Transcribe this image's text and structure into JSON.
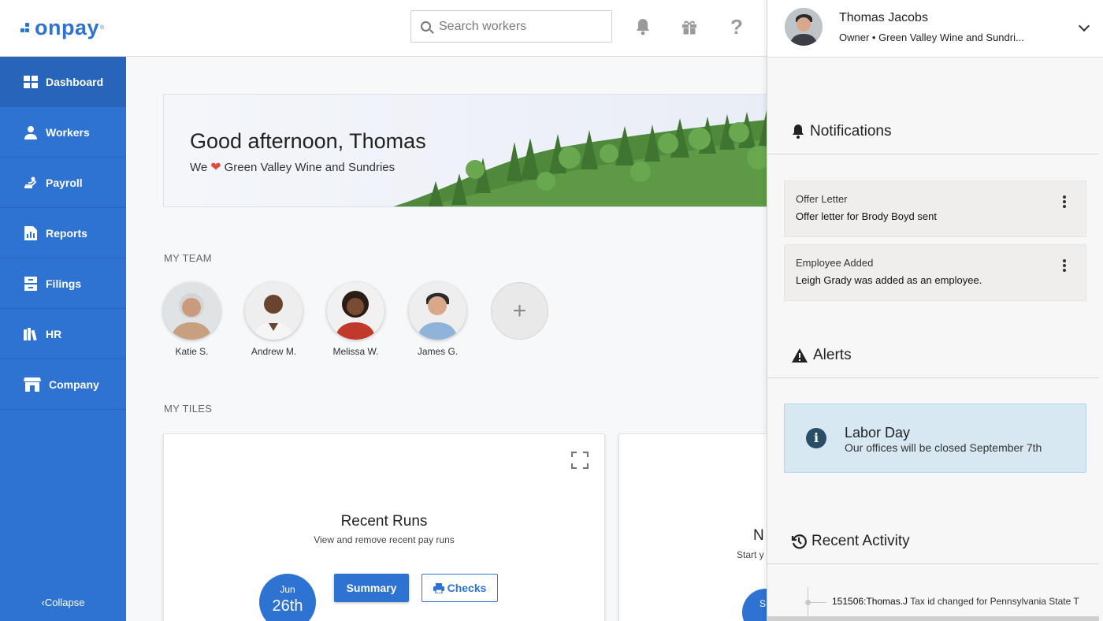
{
  "brand": {
    "name": "onpay",
    "color": "#2e72d2"
  },
  "search": {
    "placeholder": "Search workers"
  },
  "topbar_icons": [
    "bell-icon",
    "gift-icon",
    "help-icon"
  ],
  "user": {
    "name": "Thomas Jacobs",
    "role": "Owner • Green Valley Wine and Sundri..."
  },
  "sidebar": {
    "items": [
      {
        "label": "Dashboard",
        "icon": "dashboard-icon",
        "active": true
      },
      {
        "label": "Workers",
        "icon": "workers-icon"
      },
      {
        "label": "Payroll",
        "icon": "payroll-icon"
      },
      {
        "label": "Reports",
        "icon": "reports-icon"
      },
      {
        "label": "Filings",
        "icon": "filings-icon"
      },
      {
        "label": "HR",
        "icon": "hr-icon"
      },
      {
        "label": "Company",
        "icon": "company-icon"
      }
    ],
    "collapse_label": "Collapse"
  },
  "banner": {
    "greeting": "Good afternoon, Thomas",
    "sub_prefix": "We",
    "sub_company": "Green Valley Wine and Sundries"
  },
  "team": {
    "title": "MY TEAM",
    "members": [
      {
        "name": "Katie S."
      },
      {
        "name": "Andrew M."
      },
      {
        "name": "Melissa W."
      },
      {
        "name": "James G."
      }
    ]
  },
  "tiles": {
    "title": "MY TILES",
    "recent_runs": {
      "title": "Recent Runs",
      "subtitle": "View and remove recent pay runs",
      "date_month": "Jun",
      "date_day": "26th",
      "summary_label": "Summary",
      "checks_label": "Checks"
    },
    "second": {
      "title_fragment": "N",
      "subtitle_fragment": "Start y",
      "date_fragment": "S"
    }
  },
  "notifications": {
    "title": "Notifications",
    "items": [
      {
        "title": "Offer Letter",
        "text": "Offer letter for Brody Boyd sent"
      },
      {
        "title": "Employee Added",
        "text": "Leigh Grady was added as an employee."
      }
    ]
  },
  "alerts": {
    "title": "Alerts",
    "items": [
      {
        "title": "Labor Day",
        "text": "Our offices will be closed September 7th"
      }
    ]
  },
  "recent_activity": {
    "title": "Recent Activity",
    "items": [
      {
        "user": "151506:Thomas.J",
        "text": "Tax id changed for Pennsylvania State T"
      }
    ]
  }
}
